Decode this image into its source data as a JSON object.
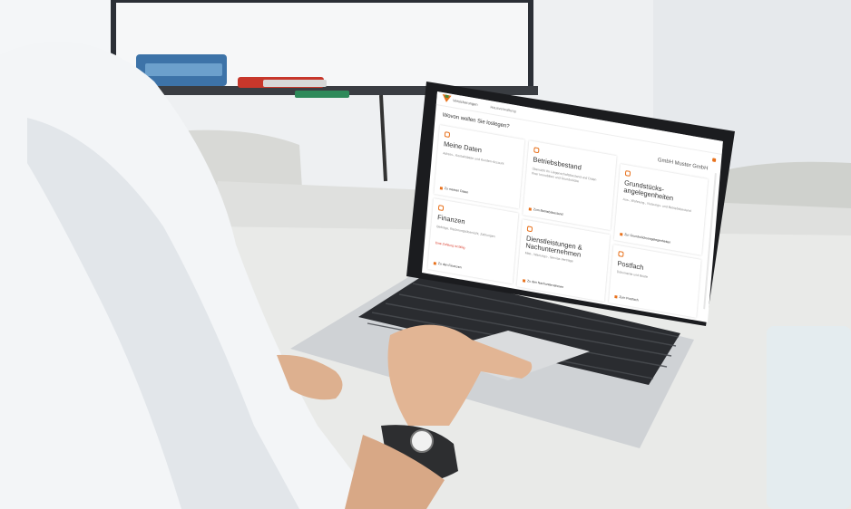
{
  "screen": {
    "brand": "Versicherungen",
    "nav_item": "Hausverwaltung",
    "greeting": "Wovon wollen Sie loslegen?",
    "company": "GmbH Muster GmbH",
    "tiles": [
      {
        "title": "Meine Daten",
        "subtitle": "Adress-, Kontaktdaten und Kunden-Account",
        "link": "Zu meinen Daten"
      },
      {
        "title": "Betriebsbestand",
        "subtitle": "Übersicht Ihr Liegenschaftsbestand und Daten Ihrer Immobilien und Grundstücke",
        "link": "Zum Betriebsbestand"
      },
      {
        "title": "Grundstücks-angelegenheiten",
        "subtitle": "Aus-, Wohnung-, Nutzungs- und Betriebsbestand",
        "link": "Zur Grundstücksangelegenheiten"
      },
      {
        "title": "Finanzen",
        "subtitle": "Beiträge, Rechnungsübersicht, Zahlungen",
        "warning": "Eine Zahlung ist fällig",
        "link": "Zu den Finanzen"
      },
      {
        "title": "Dienstleistungen & Nachunternehmen",
        "subtitle": "Miet-, Wartungs-, Service-Verträge",
        "link": "Zu den Nachunternehmen"
      },
      {
        "title": "Postfach",
        "subtitle": "Dokumente und Briefe",
        "link": "Zum Postfach"
      }
    ]
  }
}
